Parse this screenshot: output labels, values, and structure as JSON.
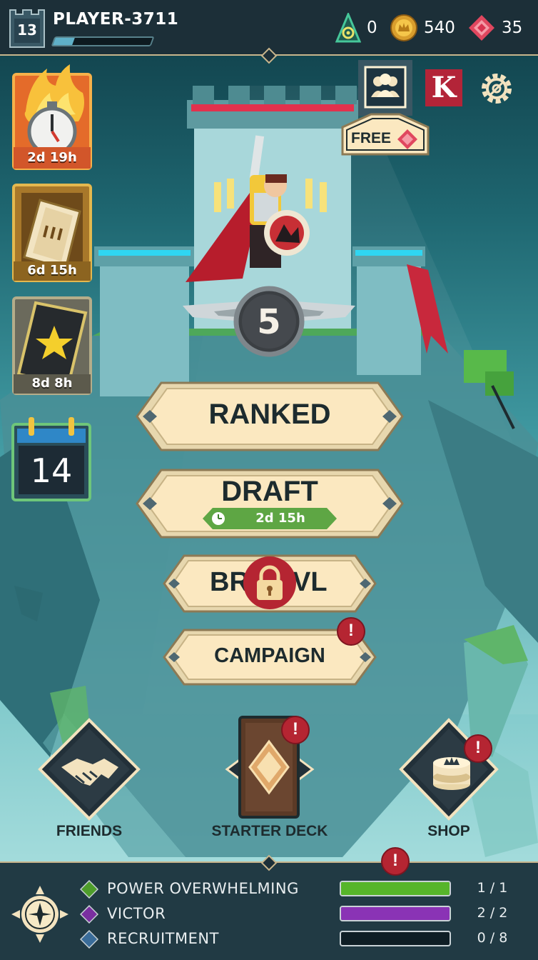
{
  "player": {
    "level": "13",
    "name": "PLAYER-3711",
    "xp_progress": 0.2
  },
  "currencies": [
    {
      "icon": "shard-icon",
      "value": "0"
    },
    {
      "icon": "gold-coin-icon",
      "value": "540"
    },
    {
      "icon": "gem-icon",
      "value": "35"
    }
  ],
  "top_right": {
    "friends_icon": "group-icon",
    "free_label": "FREE",
    "k_icon": "K",
    "settings_icon": "gear-icon"
  },
  "events": [
    {
      "icon": "stopwatch-fire-icon",
      "timer": "2d 19h"
    },
    {
      "icon": "card-pack-icon",
      "timer": "6d 15h"
    },
    {
      "icon": "star-card-icon",
      "timer": "8d 8h"
    }
  ],
  "calendar": {
    "day": "14"
  },
  "rank": {
    "value": "5"
  },
  "modes": {
    "ranked": "RANKED",
    "draft": "DRAFT",
    "draft_timer": "2d 15h",
    "brawl_left": "BR",
    "brawl_right": "VL",
    "campaign": "CAMPAIGN"
  },
  "nav": {
    "friends": "FRIENDS",
    "starter_deck": "STARTER DECK",
    "shop": "SHOP"
  },
  "alert_mark": "!",
  "quests": [
    {
      "name": "POWER OVERWHELMING",
      "count": "1 / 1",
      "progress": 1.0,
      "color": "#56b52a",
      "diamond": "#4e9d2b"
    },
    {
      "name": "VICTOR",
      "count": "2 / 2",
      "progress": 1.0,
      "color": "#8a33b5",
      "diamond": "#7a2fa0"
    },
    {
      "name": "RECRUITMENT",
      "count": "0 / 8",
      "progress": 0.0,
      "color": "#3c7fb0",
      "diamond": "#3a6c99"
    }
  ],
  "colors": {
    "topbar": "#1c2f38",
    "button_face": "#fbe8c0",
    "button_border": "#c8b58c",
    "alert": "#b52532",
    "timer_green": "#5ea644"
  }
}
